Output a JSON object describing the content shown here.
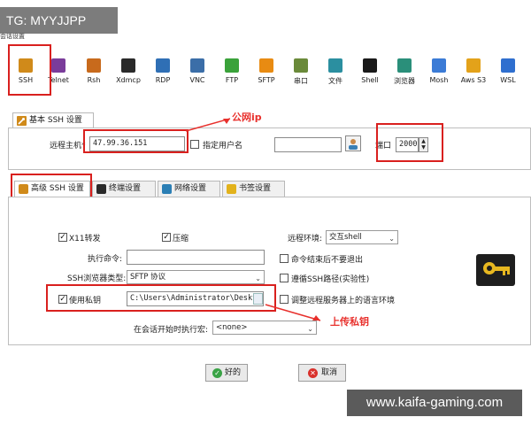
{
  "watermark_top": "TG: MYYJJPP",
  "window_title": "会话设置",
  "protocols": [
    {
      "label": "SSH",
      "icon": "wrench-icon",
      "color": "#d08a1a"
    },
    {
      "label": "Telnet",
      "icon": "telnet-icon",
      "color": "#7a3c9a"
    },
    {
      "label": "Rsh",
      "icon": "rsh-icon",
      "color": "#c86a1c"
    },
    {
      "label": "Xdmcp",
      "icon": "x-icon",
      "color": "#2a2a2a"
    },
    {
      "label": "RDP",
      "icon": "monitor-icon",
      "color": "#2f6fb5"
    },
    {
      "label": "VNC",
      "icon": "vnc-icon",
      "color": "#3b6ea8"
    },
    {
      "label": "FTP",
      "icon": "globe-icon",
      "color": "#3aa23a"
    },
    {
      "label": "SFTP",
      "icon": "sftp-icon",
      "color": "#e88b12"
    },
    {
      "label": "串口",
      "icon": "serial-icon",
      "color": "#6a8a3a"
    },
    {
      "label": "文件",
      "icon": "file-monitor-icon",
      "color": "#2b8fa0"
    },
    {
      "label": "Shell",
      "icon": "terminal-icon",
      "color": "#1a1a1a"
    },
    {
      "label": "浏览器",
      "icon": "browser-icon",
      "color": "#2a8f7a"
    },
    {
      "label": "Mosh",
      "icon": "mosh-icon",
      "color": "#3b7bd6"
    },
    {
      "label": "Aws S3",
      "icon": "aws-icon",
      "color": "#e3a21a"
    },
    {
      "label": "WSL",
      "icon": "windows-icon",
      "color": "#2f6fcf"
    }
  ],
  "basic_tab": {
    "label": "基本 SSH 设置"
  },
  "host": {
    "label": "远程主机",
    "required_mark": "*",
    "value": "47.99.36.151"
  },
  "specify_user": {
    "label": "指定用户名",
    "checked": false,
    "value": ""
  },
  "port": {
    "label": "端口",
    "value": "2000"
  },
  "annotations": {
    "public_ip": "公网ip",
    "upload_key": "上传私钥"
  },
  "sub_tabs": [
    {
      "label": "高级 SSH 设置",
      "icon": "wrench-icon"
    },
    {
      "label": "终端设置",
      "icon": "terminal-icon"
    },
    {
      "label": "网络设置",
      "icon": "network-icon"
    },
    {
      "label": "书签设置",
      "icon": "star-icon"
    }
  ],
  "advanced": {
    "x11": {
      "label": "X11转发",
      "checked": true
    },
    "compress": {
      "label": "压缩",
      "checked": true
    },
    "remote_env": {
      "label": "远程环境:",
      "value": "交互shell"
    },
    "exec_cmd": {
      "label": "执行命令:",
      "value": ""
    },
    "exit_after": {
      "label": "命令结束后不要退出",
      "checked": false
    },
    "browser_type": {
      "label": "SSH浏览器类型:",
      "value": "SFTP 协议"
    },
    "follow_path": {
      "label": "遵循SSH路径(实验性)",
      "checked": false
    },
    "private_key": {
      "label": "使用私钥",
      "checked": true,
      "value": "C:\\Users\\Administrator\\Deskt"
    },
    "adjust_locale": {
      "label": "调整远程服务器上的语言环境",
      "checked": false
    },
    "macro": {
      "label": "在会话开始时执行宏:",
      "value": "<none>"
    }
  },
  "buttons": {
    "ok": "好的",
    "cancel": "取消"
  },
  "watermark_bottom": "www.kaifa-gaming.com"
}
